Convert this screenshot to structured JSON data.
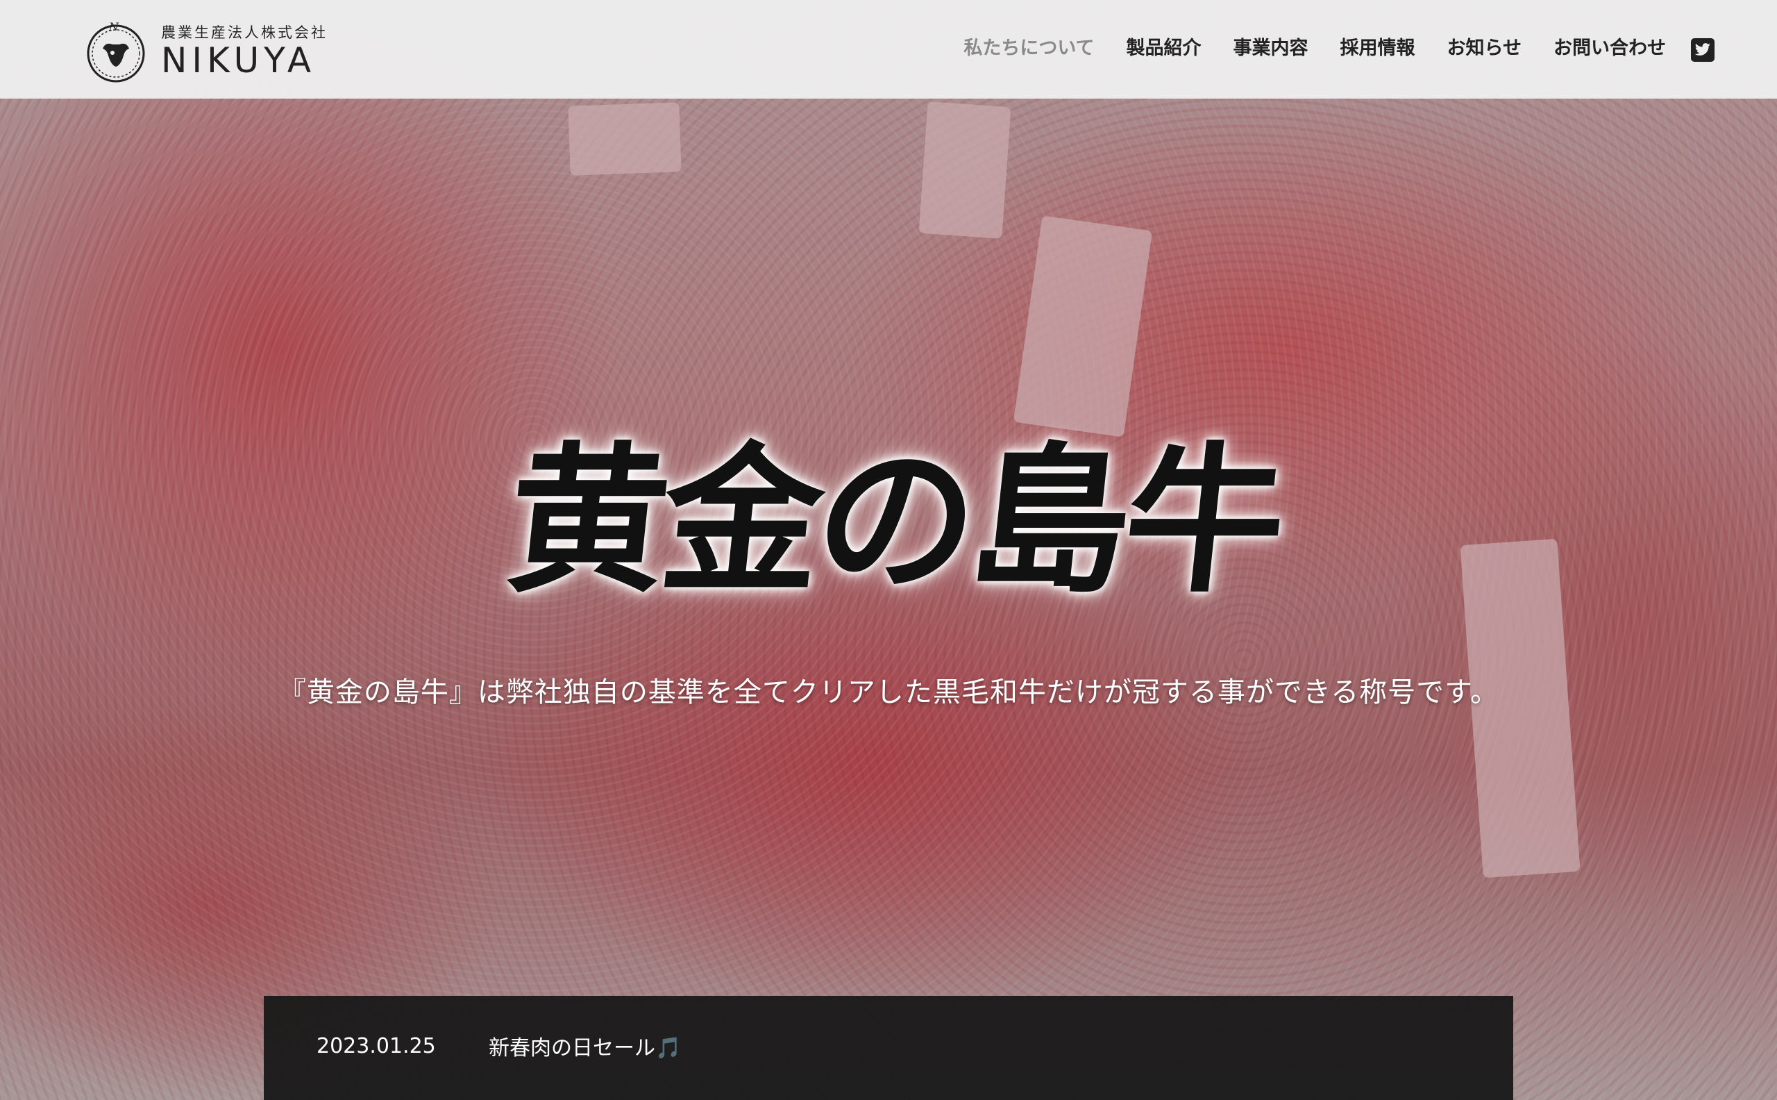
{
  "header": {
    "logo": {
      "company_type": "農業生産法人株式会社",
      "name": "NIKUYA"
    },
    "nav": [
      {
        "label": "私たちについて",
        "active": true
      },
      {
        "label": "製品紹介"
      },
      {
        "label": "事業内容"
      },
      {
        "label": "採用情報"
      },
      {
        "label": "お知らせ"
      },
      {
        "label": "お問い合わせ"
      }
    ],
    "social_icon": "twitter-icon"
  },
  "hero": {
    "brand_title": "黄金の島牛",
    "tagline": "『黄金の島牛』は弊社独自の基準を全てクリアした黒毛和牛だけが冠する事ができる称号です。"
  },
  "news": {
    "items": [
      {
        "date": "2023.01.25",
        "title": "新春肉の日セール🎵"
      }
    ]
  },
  "colors": {
    "header_bg": "#eeeeee",
    "nav_text": "#222222",
    "nav_active": "#8a8a8a",
    "news_bg": "#181818"
  }
}
